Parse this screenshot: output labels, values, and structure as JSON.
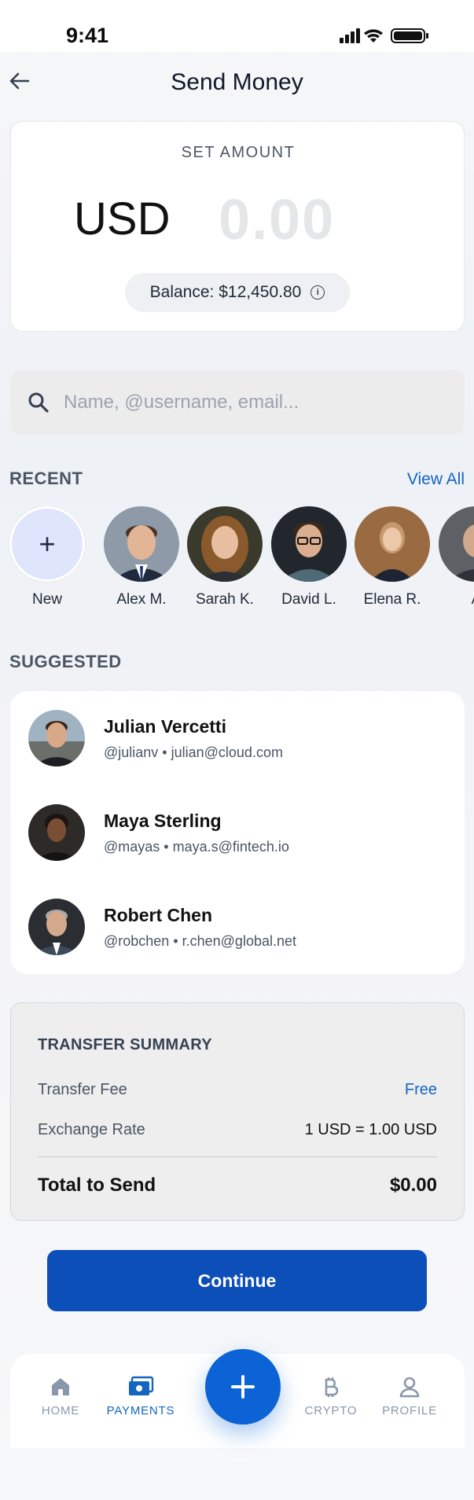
{
  "status_bar": {
    "time": "9:41"
  },
  "header": {
    "title": "Send Money"
  },
  "amount": {
    "label": "SET AMOUNT",
    "currency": "USD",
    "value": "0.00",
    "balance": "Balance: $12,450.80"
  },
  "search": {
    "placeholder": "Name, @username, email..."
  },
  "recent": {
    "title": "RECENT",
    "view_all": "View All",
    "new_label": "New",
    "contacts": [
      {
        "name": "Alex M."
      },
      {
        "name": "Sarah K."
      },
      {
        "name": "David L."
      },
      {
        "name": "Elena R."
      },
      {
        "name": "A"
      }
    ]
  },
  "suggested": {
    "title": "SUGGESTED",
    "contacts": [
      {
        "name": "Julian Vercetti",
        "handle": "@julianv • julian@cloud.com"
      },
      {
        "name": "Maya Sterling",
        "handle": "@mayas • maya.s@fintech.io"
      },
      {
        "name": "Robert Chen",
        "handle": "@robchen • r.chen@global.net"
      }
    ]
  },
  "summary": {
    "title": "TRANSFER SUMMARY",
    "fee_label": "Transfer Fee",
    "fee_value": "Free",
    "rate_label": "Exchange Rate",
    "rate_value": "1 USD = 1.00 USD",
    "total_label": "Total to Send",
    "total_value": "$0.00"
  },
  "continue_label": "Continue",
  "tabs": {
    "home": "HOME",
    "payments": "PAYMENTS",
    "crypto": "CRYPTO",
    "profile": "PROFILE"
  },
  "colors": {
    "accent": "#1565c0",
    "button": "#0d4fb8",
    "fab": "#0b63d6"
  }
}
